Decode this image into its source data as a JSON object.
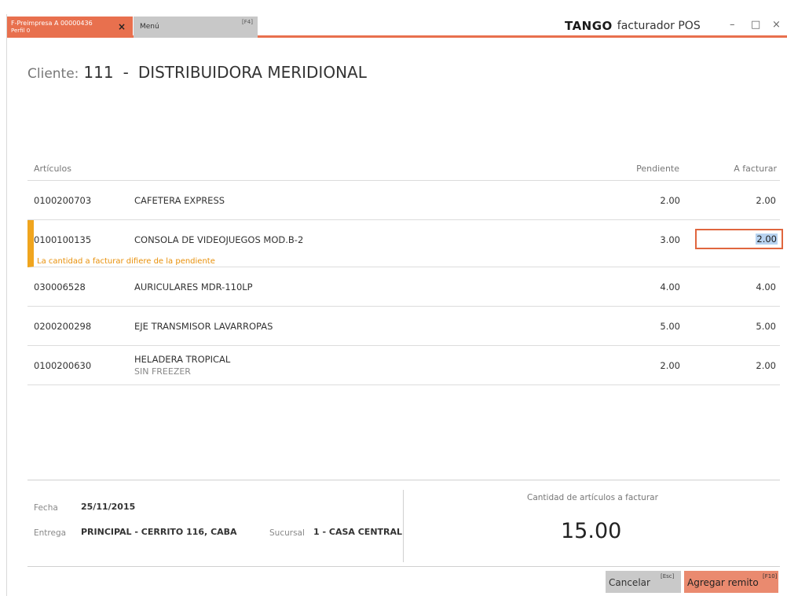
{
  "tabs": {
    "active": {
      "line1": "F-Preimpresa A 00000436",
      "line2": "Perfil 0",
      "close": "×"
    },
    "menu": {
      "label": "Menú",
      "key": "[F4]"
    }
  },
  "brand": {
    "logo": "TANGO",
    "name": "facturador POS"
  },
  "window_controls": {
    "minimize": "–",
    "maximize": "□",
    "close": "×"
  },
  "cliente": {
    "label": "Cliente:",
    "code": "111",
    "separator": "-",
    "name": "DISTRIBUIDORA MERIDIONAL"
  },
  "table": {
    "headers": {
      "articulos": "Artículos",
      "pendiente": "Pendiente",
      "a_facturar": "A facturar"
    },
    "rows": [
      {
        "code": "0100200703",
        "desc": "CAFETERA EXPRESS",
        "desc2": "",
        "pendiente": "2.00",
        "a_facturar": "2.00"
      },
      {
        "code": "0100100135",
        "desc": "CONSOLA DE VIDEOJUEGOS MOD.B-2",
        "desc2": "",
        "pendiente": "3.00",
        "a_facturar": "2.00",
        "warning": "La cantidad a facturar difiere de la pendiente"
      },
      {
        "code": "030006528",
        "desc": "AURICULARES MDR-110LP",
        "desc2": "",
        "pendiente": "4.00",
        "a_facturar": "4.00"
      },
      {
        "code": "0200200298",
        "desc": "EJE TRANSMISOR LAVARROPAS",
        "desc2": "",
        "pendiente": "5.00",
        "a_facturar": "5.00"
      },
      {
        "code": "0100200630",
        "desc": "HELADERA TROPICAL",
        "desc2": "SIN FREEZER",
        "pendiente": "2.00",
        "a_facturar": "2.00"
      }
    ]
  },
  "footer": {
    "fecha_label": "Fecha",
    "fecha": "25/11/2015",
    "entrega_label": "Entrega",
    "entrega": "PRINCIPAL - CERRITO 116, CABA",
    "sucursal_label": "Sucursal",
    "sucursal": "1 - CASA CENTRAL",
    "cantidad_label": "Cantidad de artículos a facturar",
    "cantidad_total": "15.00"
  },
  "buttons": {
    "cancel": {
      "label": "Cancelar",
      "key": "[Esc]"
    },
    "add": {
      "label": "Agregar remito",
      "key": "[F10]"
    }
  },
  "colors": {
    "accent": "#e8704e",
    "warning": "#f0a51e",
    "input_border": "#e0663e"
  }
}
